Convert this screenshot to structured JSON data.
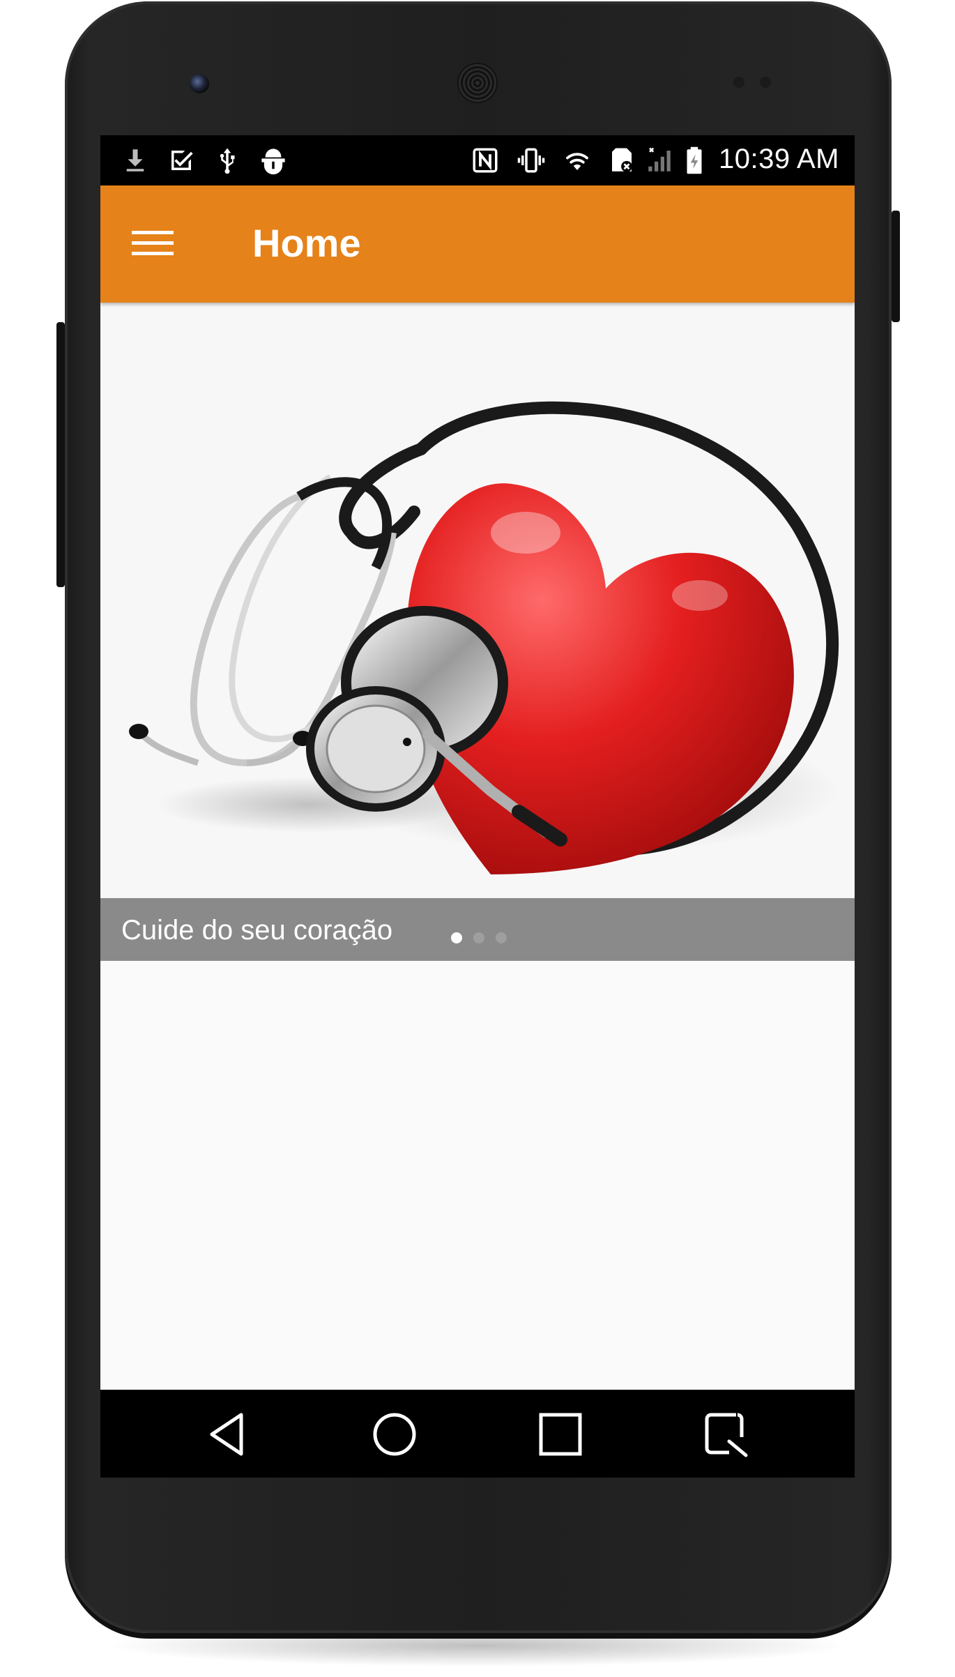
{
  "status_bar": {
    "time": "10:39 AM",
    "left_icons": [
      "download-icon",
      "checkbox-icon",
      "usb-icon",
      "android-debug-icon"
    ],
    "right_icons": [
      "nfc-icon",
      "vibrate-icon",
      "wifi-icon",
      "sd-card-icon",
      "signal-icon",
      "battery-icon"
    ]
  },
  "app_bar": {
    "title": "Home",
    "menu_icon": "hamburger-menu-icon",
    "color": "#e5821a"
  },
  "carousel": {
    "image": "heart-stethoscope-image",
    "caption": "Cuide do seu coração",
    "pages": 3,
    "active_page": 1
  },
  "nav_bar": {
    "buttons": [
      "back-icon",
      "home-icon",
      "recents-icon",
      "screenshot-icon"
    ]
  }
}
